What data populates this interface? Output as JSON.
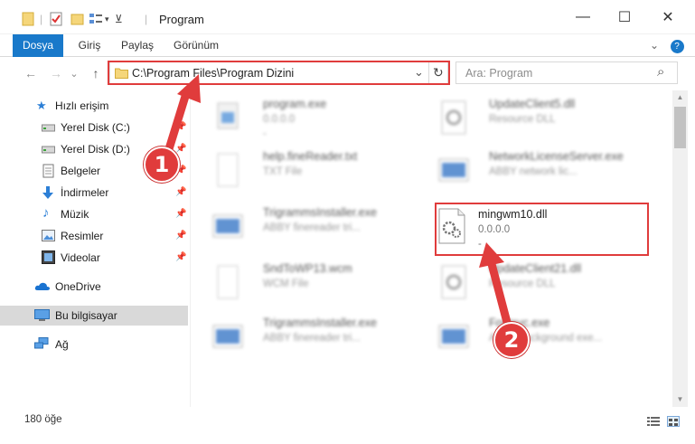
{
  "window": {
    "title": "Program",
    "minimize_glyph": "—",
    "maximize_glyph": "☐",
    "close_glyph": "✕"
  },
  "ribbon": {
    "tabs": [
      {
        "label": "Dosya",
        "active": true
      },
      {
        "label": "Giriş"
      },
      {
        "label": "Paylaş"
      },
      {
        "label": "Görünüm"
      }
    ],
    "expand_glyph": "⌄",
    "help_glyph": "?"
  },
  "address": {
    "path": "C:\\Program Files\\Program Dizini",
    "back_glyph": "←",
    "forward_glyph": "→",
    "recent_glyph": "⌄",
    "up_glyph": "↑",
    "dropdown_glyph": "⌄",
    "refresh_glyph": "↻"
  },
  "search": {
    "placeholder": "Ara: Program",
    "icon_glyph": "⌕"
  },
  "sidebar": {
    "items": [
      {
        "label": "Hızlı erişim",
        "icon": "star-icon"
      },
      {
        "label": "Yerel Disk (C:)",
        "icon": "drive-icon",
        "pinned": true
      },
      {
        "label": "Yerel Disk (D:)",
        "icon": "drive-icon",
        "pinned": true
      },
      {
        "label": "Belgeler",
        "icon": "documents-icon",
        "pinned": true
      },
      {
        "label": "İndirmeler",
        "icon": "download-icon",
        "pinned": true
      },
      {
        "label": "Müzik",
        "icon": "music-icon",
        "pinned": true
      },
      {
        "label": "Resimler",
        "icon": "pictures-icon",
        "pinned": true
      },
      {
        "label": "Videolar",
        "icon": "videos-icon",
        "pinned": true
      },
      {
        "label": "OneDrive",
        "icon": "cloud-icon"
      },
      {
        "label": "Bu bilgisayar",
        "icon": "computer-icon",
        "selected": true
      },
      {
        "label": "Ağ",
        "icon": "network-icon"
      }
    ]
  },
  "files": [
    {
      "name": "program.exe",
      "sub": "0.0.0.0",
      "sub2": "-",
      "icon": "exe-icon"
    },
    {
      "name": "UpdateClient5.dll",
      "sub": "Resource DLL",
      "icon": "dll-icon"
    },
    {
      "name": "help.fineReader.txt",
      "sub": "TXT File",
      "icon": "txt-icon"
    },
    {
      "name": "NetworkLicenseServer.exe",
      "sub": "ABBY network lic...",
      "icon": "app-icon"
    },
    {
      "name": "TrigrammsInstaller.exe",
      "sub": "ABBY finereader tri...",
      "icon": "app-icon"
    },
    {
      "name": "mingwm10.dll",
      "sub": "0.0.0.0",
      "sub2": "-",
      "icon": "dll-icon",
      "highlight": true
    },
    {
      "name": "SndToWP13.wcm",
      "sub": "WCM File",
      "icon": "txt-icon"
    },
    {
      "name": "UpdateClient21.dll",
      "sub": "Resource DLL",
      "icon": "dll-icon"
    },
    {
      "name": "TrigrammsInstaller.exe",
      "sub": "ABBY finereader tri...",
      "icon": "app-icon"
    },
    {
      "name": "Fontsvc.exe",
      "sub": "ABBY background exe...",
      "icon": "app-icon"
    }
  ],
  "status": {
    "count": "180 öğe"
  },
  "annotations": {
    "step1": "1",
    "step2": "2"
  },
  "colors": {
    "accent": "#1979ca",
    "annotation_red": "#e03c3c",
    "selected_bg": "#d9d9d9"
  }
}
